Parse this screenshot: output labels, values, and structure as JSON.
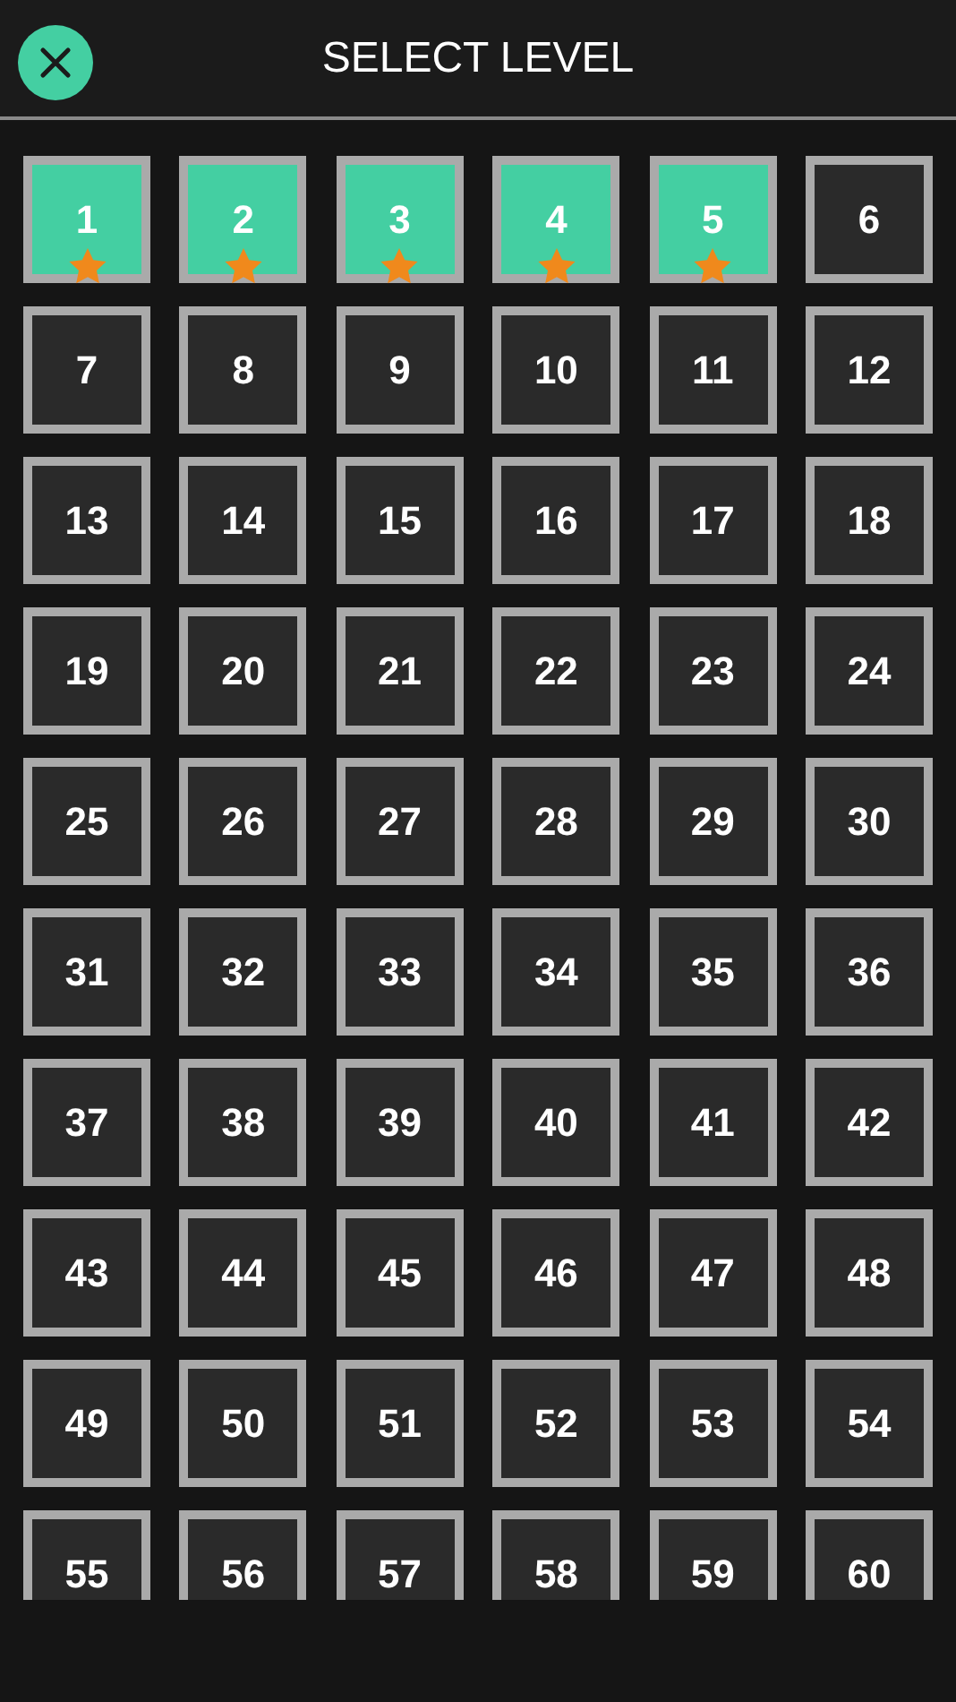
{
  "header": {
    "title": "SELECT LEVEL"
  },
  "levels": [
    {
      "number": "1",
      "completed": true,
      "starred": true
    },
    {
      "number": "2",
      "completed": true,
      "starred": true
    },
    {
      "number": "3",
      "completed": true,
      "starred": true
    },
    {
      "number": "4",
      "completed": true,
      "starred": true
    },
    {
      "number": "5",
      "completed": true,
      "starred": true
    },
    {
      "number": "6",
      "completed": false,
      "starred": false
    },
    {
      "number": "7",
      "completed": false,
      "starred": false
    },
    {
      "number": "8",
      "completed": false,
      "starred": false
    },
    {
      "number": "9",
      "completed": false,
      "starred": false
    },
    {
      "number": "10",
      "completed": false,
      "starred": false
    },
    {
      "number": "11",
      "completed": false,
      "starred": false
    },
    {
      "number": "12",
      "completed": false,
      "starred": false
    },
    {
      "number": "13",
      "completed": false,
      "starred": false
    },
    {
      "number": "14",
      "completed": false,
      "starred": false
    },
    {
      "number": "15",
      "completed": false,
      "starred": false
    },
    {
      "number": "16",
      "completed": false,
      "starred": false
    },
    {
      "number": "17",
      "completed": false,
      "starred": false
    },
    {
      "number": "18",
      "completed": false,
      "starred": false
    },
    {
      "number": "19",
      "completed": false,
      "starred": false
    },
    {
      "number": "20",
      "completed": false,
      "starred": false
    },
    {
      "number": "21",
      "completed": false,
      "starred": false
    },
    {
      "number": "22",
      "completed": false,
      "starred": false
    },
    {
      "number": "23",
      "completed": false,
      "starred": false
    },
    {
      "number": "24",
      "completed": false,
      "starred": false
    },
    {
      "number": "25",
      "completed": false,
      "starred": false
    },
    {
      "number": "26",
      "completed": false,
      "starred": false
    },
    {
      "number": "27",
      "completed": false,
      "starred": false
    },
    {
      "number": "28",
      "completed": false,
      "starred": false
    },
    {
      "number": "29",
      "completed": false,
      "starred": false
    },
    {
      "number": "30",
      "completed": false,
      "starred": false
    },
    {
      "number": "31",
      "completed": false,
      "starred": false
    },
    {
      "number": "32",
      "completed": false,
      "starred": false
    },
    {
      "number": "33",
      "completed": false,
      "starred": false
    },
    {
      "number": "34",
      "completed": false,
      "starred": false
    },
    {
      "number": "35",
      "completed": false,
      "starred": false
    },
    {
      "number": "36",
      "completed": false,
      "starred": false
    },
    {
      "number": "37",
      "completed": false,
      "starred": false
    },
    {
      "number": "38",
      "completed": false,
      "starred": false
    },
    {
      "number": "39",
      "completed": false,
      "starred": false
    },
    {
      "number": "40",
      "completed": false,
      "starred": false
    },
    {
      "number": "41",
      "completed": false,
      "starred": false
    },
    {
      "number": "42",
      "completed": false,
      "starred": false
    },
    {
      "number": "43",
      "completed": false,
      "starred": false
    },
    {
      "number": "44",
      "completed": false,
      "starred": false
    },
    {
      "number": "45",
      "completed": false,
      "starred": false
    },
    {
      "number": "46",
      "completed": false,
      "starred": false
    },
    {
      "number": "47",
      "completed": false,
      "starred": false
    },
    {
      "number": "48",
      "completed": false,
      "starred": false
    },
    {
      "number": "49",
      "completed": false,
      "starred": false
    },
    {
      "number": "50",
      "completed": false,
      "starred": false
    },
    {
      "number": "51",
      "completed": false,
      "starred": false
    },
    {
      "number": "52",
      "completed": false,
      "starred": false
    },
    {
      "number": "53",
      "completed": false,
      "starred": false
    },
    {
      "number": "54",
      "completed": false,
      "starred": false
    },
    {
      "number": "55",
      "completed": false,
      "starred": false
    },
    {
      "number": "56",
      "completed": false,
      "starred": false
    },
    {
      "number": "57",
      "completed": false,
      "starred": false
    },
    {
      "number": "58",
      "completed": false,
      "starred": false
    },
    {
      "number": "59",
      "completed": false,
      "starred": false
    },
    {
      "number": "60",
      "completed": false,
      "starred": false
    }
  ]
}
